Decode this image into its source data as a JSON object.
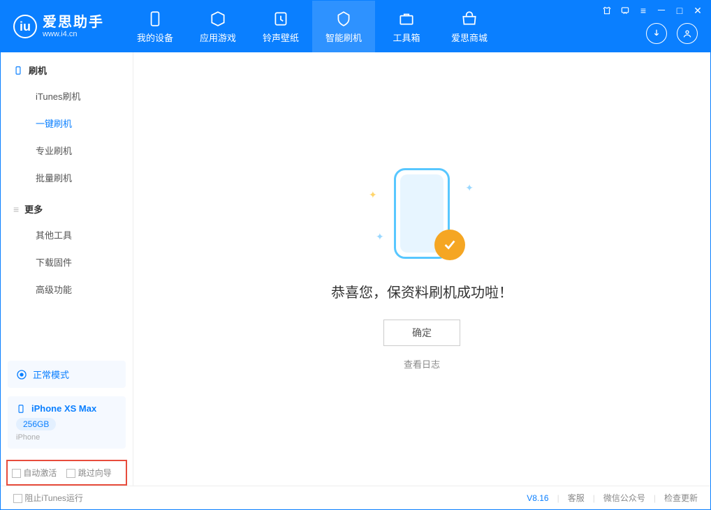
{
  "app": {
    "name_cn": "爱思助手",
    "name_en": "www.i4.cn"
  },
  "tabs": {
    "device": "我的设备",
    "apps": "应用游戏",
    "ringtones": "铃声壁纸",
    "flash": "智能刷机",
    "tools": "工具箱",
    "store": "爱思商城"
  },
  "sidebar": {
    "flash_title": "刷机",
    "items": {
      "itunes": "iTunes刷机",
      "onekey": "一键刷机",
      "pro": "专业刷机",
      "batch": "批量刷机"
    },
    "more_title": "更多",
    "more_items": {
      "other": "其他工具",
      "firmware": "下载固件",
      "advanced": "高级功能"
    }
  },
  "mode": {
    "label": "正常模式"
  },
  "device": {
    "name": "iPhone XS Max",
    "capacity": "256GB",
    "type": "iPhone"
  },
  "options": {
    "auto_activate": "自动激活",
    "skip_guide": "跳过向导"
  },
  "main": {
    "success": "恭喜您，保资料刷机成功啦！",
    "ok": "确定",
    "view_log": "查看日志"
  },
  "footer": {
    "block_itunes": "阻止iTunes运行",
    "version": "V8.16",
    "support": "客服",
    "wechat": "微信公众号",
    "update": "检查更新"
  }
}
